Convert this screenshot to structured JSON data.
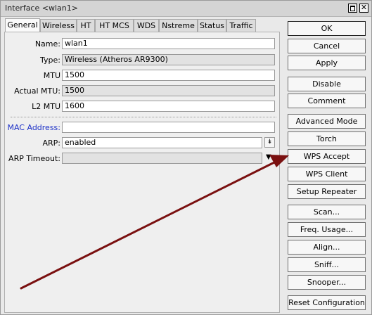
{
  "window": {
    "title": "Interface <wlan1>",
    "close_glyph": "✕"
  },
  "tabs": [
    "General",
    "Wireless",
    "HT",
    "HT MCS",
    "WDS",
    "Nstreme",
    "Status",
    "Traffic"
  ],
  "fields": {
    "name": {
      "label": "Name:",
      "value": "wlan1"
    },
    "type": {
      "label": "Type:",
      "value": "Wireless (Atheros AR9300)"
    },
    "mtu": {
      "label": "MTU",
      "value": "1500"
    },
    "actual_mtu": {
      "label": "Actual MTU:",
      "value": "1500"
    },
    "l2_mtu": {
      "label": "L2 MTU",
      "value": "1600"
    },
    "mac_address": {
      "label": "MAC Address:",
      "value": ""
    },
    "arp": {
      "label": "ARP:",
      "value": "enabled"
    },
    "arp_timeout": {
      "label": "ARP Timeout:",
      "value": ""
    }
  },
  "buttons": {
    "ok": "OK",
    "cancel": "Cancel",
    "apply": "Apply",
    "disable": "Disable",
    "comment": "Comment",
    "advanced_mode": "Advanced Mode",
    "torch": "Torch",
    "wps_accept": "WPS Accept",
    "wps_client": "WPS Client",
    "setup_repeater": "Setup Repeater",
    "scan": "Scan...",
    "freq_usage": "Freq. Usage...",
    "align": "Align...",
    "sniff": "Sniff...",
    "snooper": "Snooper...",
    "reset_configuration": "Reset Configuration"
  },
  "colors": {
    "annotation_arrow": "#7a1010",
    "mac_label": "#1e32c8"
  },
  "icons": {
    "arp_dropdown": "↡",
    "arp_timeout_dropdown": "▼"
  }
}
